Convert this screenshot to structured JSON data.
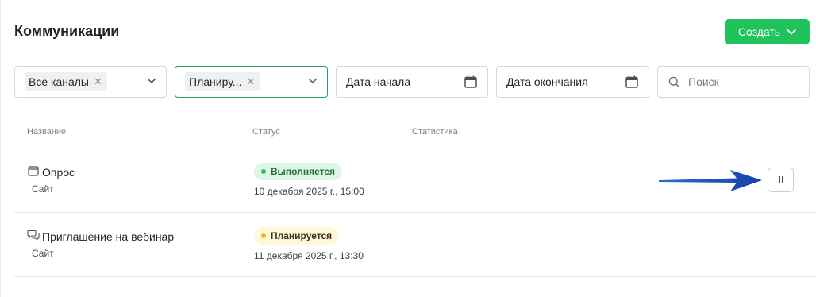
{
  "page": {
    "title": "Коммуникации"
  },
  "toolbar": {
    "create_label": "Создать"
  },
  "filters": {
    "channels": {
      "chip": "Все каналы"
    },
    "status": {
      "chip": "Планиру..."
    },
    "date_start": {
      "label": "Дата начала"
    },
    "date_end": {
      "label": "Дата окончания"
    },
    "search": {
      "placeholder": "Поиск"
    }
  },
  "table": {
    "columns": [
      "Название",
      "Статус",
      "Статистика"
    ],
    "rows": [
      {
        "icon": "calendar-window-icon",
        "name": "Опрос",
        "channel": "Сайт",
        "status": "Выполняется",
        "status_color": "#1fc25b",
        "date": "10 декабря 2025 г., 15:00",
        "action_icon": "pause-icon"
      },
      {
        "icon": "chat-bubbles-icon",
        "name": "Приглашение на вебинар",
        "channel": "Сайт",
        "status": "Планируется",
        "status_color": "#f2b90c",
        "date": "11 декабря 2025 г., 13:30"
      }
    ]
  },
  "colors": {
    "accent": "#1fc25b",
    "annotation_arrow": "#1a4fb5"
  }
}
